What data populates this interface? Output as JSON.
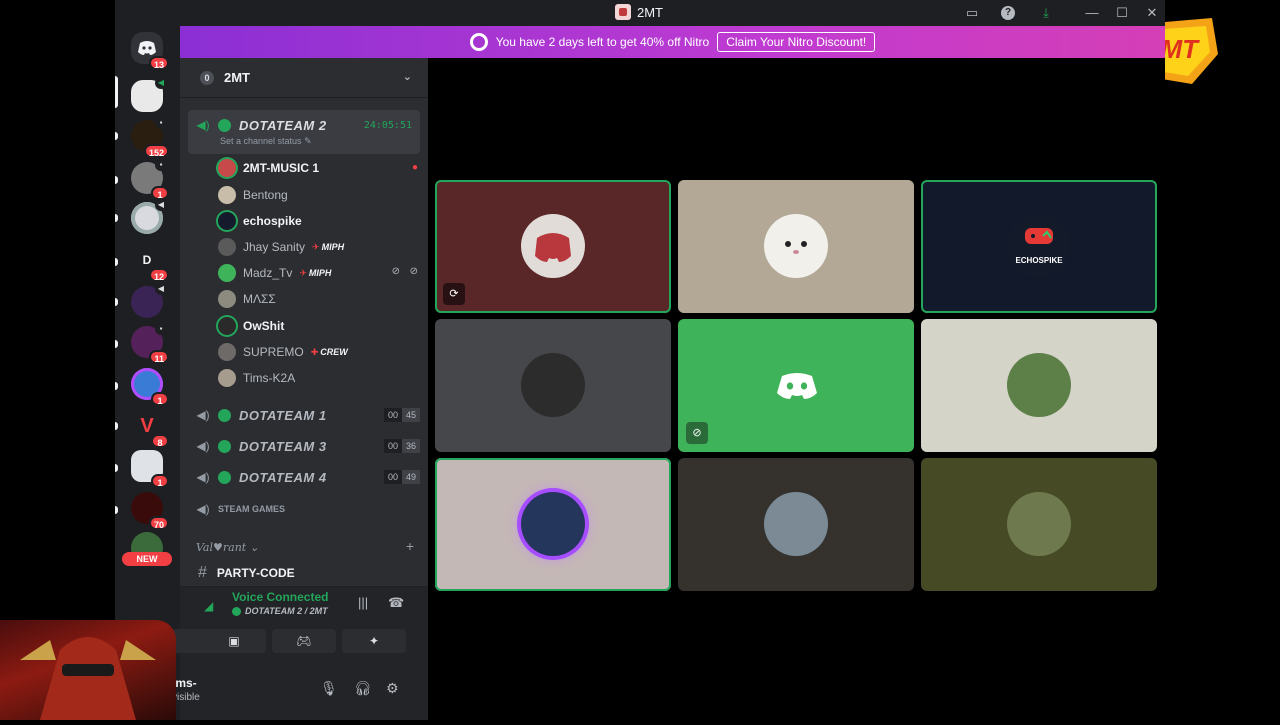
{
  "window": {
    "title": "2MT"
  },
  "banner": {
    "text": "You have 2 days left to get 40% off Nitro",
    "button": "Claim Your Nitro Discount!"
  },
  "rail": {
    "home_badge": "13",
    "servers": [
      {
        "badge": "152"
      },
      {
        "badge": "1"
      },
      {
        "initial": "D",
        "badge": "12"
      },
      {
        "badge": "11"
      },
      {
        "badge": "1"
      },
      {
        "badge": "8"
      },
      {
        "badge": "1"
      },
      {
        "badge": "70"
      }
    ],
    "new_label": "NEW"
  },
  "guild": {
    "name": "2MT",
    "zero": "0"
  },
  "active_channel": {
    "name": "DOTATEAM 2",
    "timer": "24:05:51",
    "status": "Set a channel status",
    "members": [
      {
        "name": "2MT-MUSIC 1",
        "active": true
      },
      {
        "name": "Bentong",
        "active": false
      },
      {
        "name": "echospike",
        "active": true
      },
      {
        "name": "Jhay Sanity",
        "active": false,
        "tag": "MIPH"
      },
      {
        "name": "Madz_Tv",
        "active": false,
        "tag": "MIPH"
      },
      {
        "name": "ΜΛΣΣ",
        "active": false
      },
      {
        "name": "OwShit",
        "active": true
      },
      {
        "name": "SUPREMO",
        "active": false,
        "tag": "CREW"
      },
      {
        "name": "Tims-K2A",
        "active": false
      }
    ]
  },
  "other_channels": [
    {
      "name": "DOTATEAM 1",
      "count_a": "00",
      "count_b": "45"
    },
    {
      "name": "DOTATEAM 3",
      "count_a": "00",
      "count_b": "36"
    },
    {
      "name": "DOTATEAM 4",
      "count_a": "00",
      "count_b": "49"
    }
  ],
  "steam_channel": "STEAM GAMES",
  "category": "Val♥rant",
  "text_channel": "PARTY-CODE",
  "voice": {
    "title": "Voice Connected",
    "channel": "DOTATEAM 2 / 2MT"
  },
  "user": {
    "name": "ims-",
    "status": "visible"
  },
  "tiles": [
    {
      "bg": "#5a2729",
      "speaking": true,
      "icon": "activity"
    },
    {
      "bg": "#b3a895",
      "speaking": false
    },
    {
      "bg": "#12192a",
      "speaking": true,
      "label": "ECHOSPIKE"
    },
    {
      "bg": "#46474b",
      "speaking": false
    },
    {
      "bg": "#3fb35a",
      "speaking": false,
      "icon": "deafened"
    },
    {
      "bg": "#d4d4c8",
      "speaking": false
    },
    {
      "bg": "#c4b8b6",
      "speaking": true
    },
    {
      "bg": "#35322d",
      "speaking": false
    },
    {
      "bg": "#464a25",
      "speaking": false
    }
  ],
  "colors": {
    "accent_green": "#23a55a",
    "badge_red": "#f23f43",
    "nitro_purple": "#8b2fd4"
  }
}
